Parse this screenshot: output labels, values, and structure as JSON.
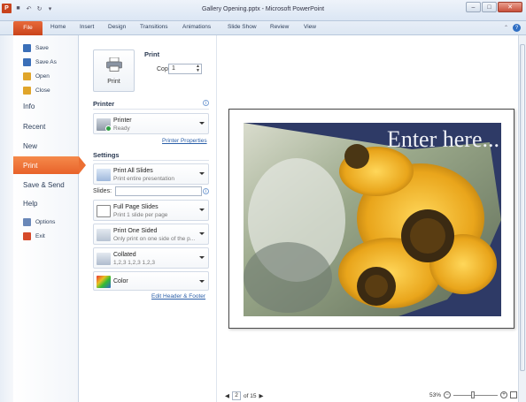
{
  "window": {
    "title": "Gallery Opening.pptx - Microsoft PowerPoint",
    "app_icon": "P",
    "quick_access": [
      "save-icon",
      "undo-icon",
      "redo-icon",
      "customize-icon"
    ]
  },
  "ribbon": {
    "tabs": [
      "File",
      "Home",
      "Insert",
      "Design",
      "Transitions",
      "Animations",
      "Slide Show",
      "Review",
      "View"
    ]
  },
  "nav": {
    "items_small": [
      {
        "label": "Save",
        "icon": "save-icon",
        "color": "#3a6fb8"
      },
      {
        "label": "Save As",
        "icon": "save-as-icon",
        "color": "#3a6fb8"
      },
      {
        "label": "Open",
        "icon": "open-folder-icon",
        "color": "#e0a52a"
      },
      {
        "label": "Close",
        "icon": "close-folder-icon",
        "color": "#e0a52a"
      }
    ],
    "items_big": [
      "Info",
      "Recent",
      "New",
      "Print",
      "Save & Send",
      "Help"
    ],
    "active": "Print",
    "items_bottom": [
      {
        "label": "Options",
        "icon": "options-icon",
        "color": "#6a88b8"
      },
      {
        "label": "Exit",
        "icon": "exit-icon",
        "color": "#d64a2a"
      }
    ]
  },
  "print": {
    "section_title": "Print",
    "button_label": "Print",
    "copies_label": "Copies:",
    "copies_value": "1"
  },
  "printer": {
    "section_title": "Printer",
    "name": "Printer",
    "status": "Ready",
    "properties_link": "Printer Properties"
  },
  "settings": {
    "section_title": "Settings",
    "range": {
      "title": "Print All Slides",
      "subtitle": "Print entire presentation"
    },
    "slides_label": "Slides:",
    "slides_value": "",
    "layout": {
      "title": "Full Page Slides",
      "subtitle": "Print 1 slide per page"
    },
    "sides": {
      "title": "Print One Sided",
      "subtitle": "Only print on one side of the p..."
    },
    "collation": {
      "title": "Collated",
      "subtitle": "1,2,3    1,2,3    1,2,3"
    },
    "color": {
      "title": "Color"
    },
    "header_footer_link": "Edit Header & Footer"
  },
  "preview": {
    "slide_heading": "Enter here...",
    "current_page": "2",
    "total_pages_text": "of 15",
    "zoom_level": "53%",
    "zoom_fraction": 0.53
  },
  "colors": {
    "file_tab": "#d9531e",
    "active_nav": "#ec6f33",
    "slide_bg": "#2e3a66",
    "link": "#2b5fa8"
  }
}
